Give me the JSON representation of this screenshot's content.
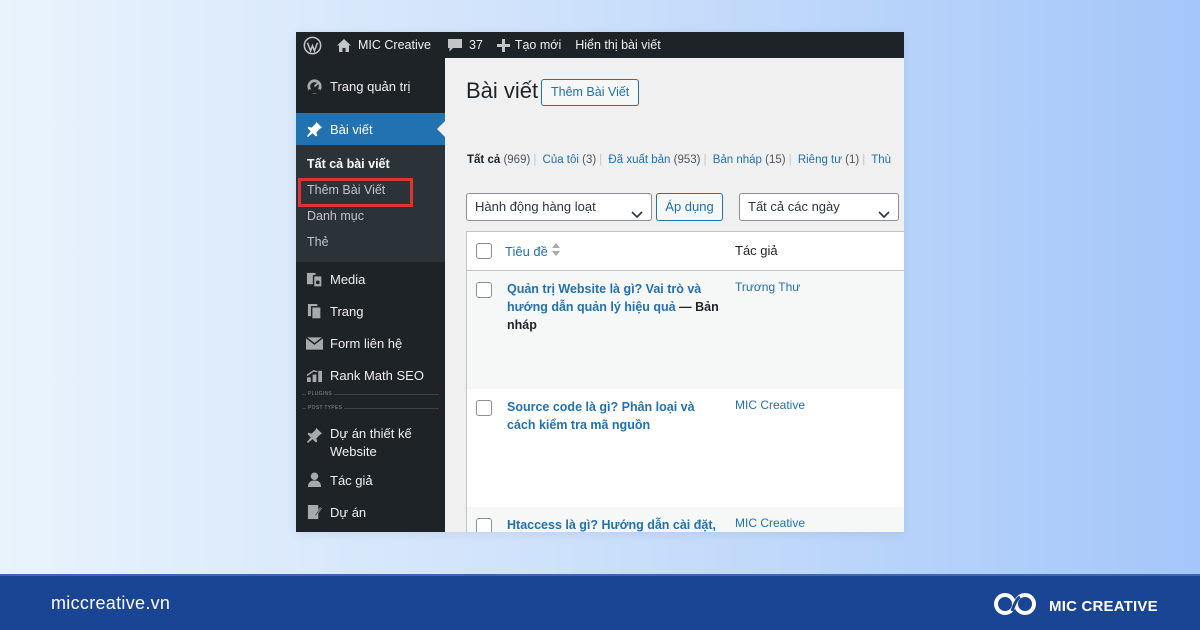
{
  "colors": {
    "adminbar": "#1d2327",
    "accent": "#2271b1",
    "highlight": "#e03232",
    "footer": "#1a4494"
  },
  "adminbar": {
    "logo_icon": "wordpress-icon",
    "home_icon": "home-icon",
    "site_name": "MIC Creative",
    "comments_icon": "comment-icon",
    "comments_count": "37",
    "new_icon": "plus-icon",
    "new_label": "Tạo mới",
    "view_label": "Hiển thị bài viết"
  },
  "sidebar": {
    "dashboard": "Trang quản trị",
    "posts": "Bài viết",
    "submenu": [
      "Tất cả bài viết",
      "Thêm Bài Viết",
      "Danh mục",
      "Thẻ"
    ],
    "media": "Media",
    "pages": "Trang",
    "contact_form": "Form liên hệ",
    "rank_math": "Rank Math SEO",
    "plugins_sep": "PLUGINS",
    "post_types_sep": "POST TYPES",
    "projects_design": "Dự án thiết kế Website",
    "authors": "Tác giả",
    "projects": "Dự án"
  },
  "main": {
    "title": "Bài viết",
    "add_new": "Thêm Bài Viết",
    "filters": [
      {
        "label": "Tất cả",
        "count": "(969)"
      },
      {
        "label": "Của tôi",
        "count": "(3)"
      },
      {
        "label": "Đã xuất bản",
        "count": "(953)"
      },
      {
        "label": "Bản nháp",
        "count": "(15)"
      },
      {
        "label": "Riêng tư",
        "count": "(1)"
      },
      {
        "label": "Thù",
        "count": ""
      }
    ],
    "bulk_action": "Hành động hàng loạt",
    "apply": "Áp dụng",
    "date_filter": "Tất cả các ngày",
    "columns": {
      "title": "Tiêu đề",
      "author": "Tác giả"
    },
    "posts": [
      {
        "title": "Quản trị Website là gì? Vai trò và hướng dẫn quản lý hiệu quả",
        "state": "— Bản nháp",
        "author": "Trương Thư"
      },
      {
        "title": "Source code là gì? Phân loại và cách kiểm tra mã nguồn",
        "state": "",
        "author": "MIC Creative"
      },
      {
        "title": "Htaccess là gì? Hướng dẫn cài đặt, cấu hình file đơn giản và hiệu quả",
        "state": "",
        "author": "MIC Creative"
      }
    ]
  },
  "footer": {
    "website": "miccreative.vn",
    "brand_logo": "mic-creative-logo",
    "brand_name": "MIC CREATIVE"
  }
}
